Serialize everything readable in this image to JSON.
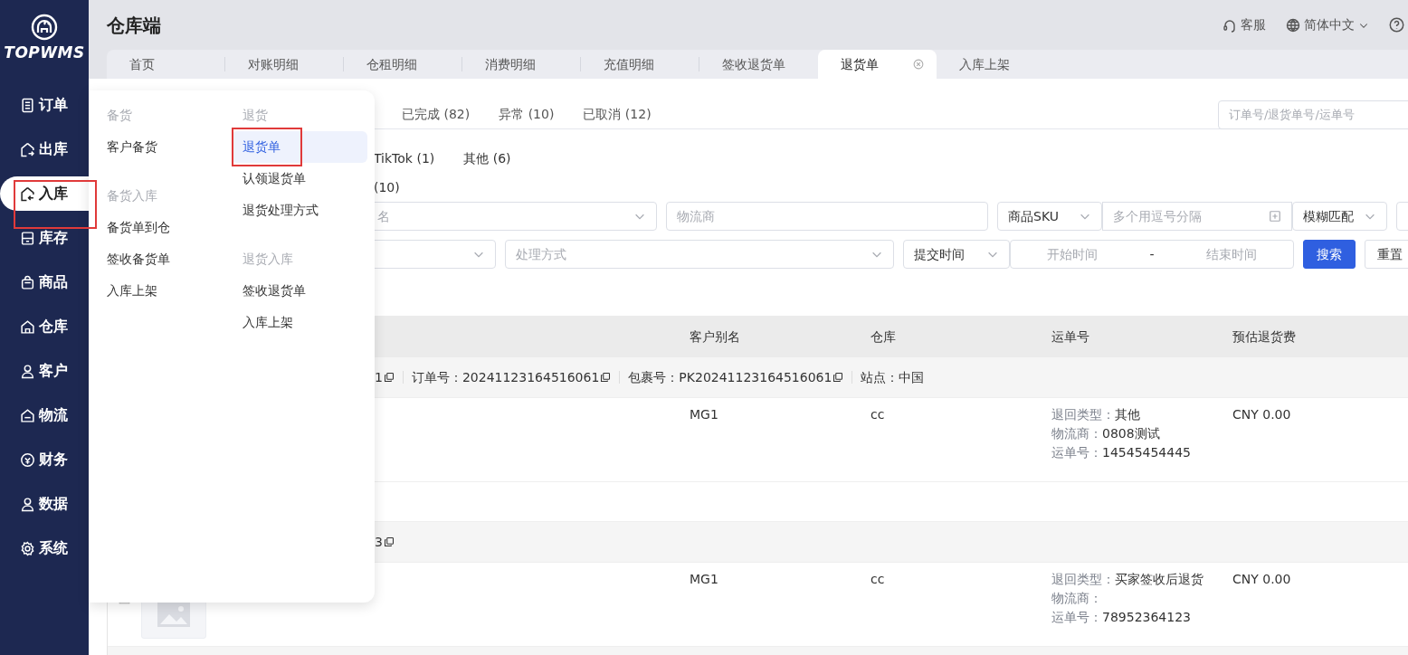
{
  "app": {
    "logo": "TOPWMS",
    "title": "仓库端"
  },
  "header_actions": [
    {
      "kind": "support",
      "label": "客服"
    },
    {
      "kind": "language",
      "label": "简体中文"
    },
    {
      "kind": "help"
    }
  ],
  "sidebar": {
    "items": [
      {
        "kind": "order",
        "label": "订单",
        "selected": false
      },
      {
        "kind": "outbound",
        "label": "出库",
        "selected": false
      },
      {
        "kind": "inbound",
        "label": "入库",
        "selected": true,
        "highlighted": true
      },
      {
        "kind": "inventory",
        "label": "库存",
        "selected": false
      },
      {
        "kind": "product",
        "label": "商品",
        "selected": false
      },
      {
        "kind": "warehouse",
        "label": "仓库",
        "selected": false
      },
      {
        "kind": "customer",
        "label": "客户",
        "selected": false
      },
      {
        "kind": "logistics",
        "label": "物流",
        "selected": false
      },
      {
        "kind": "finance",
        "label": "财务",
        "selected": false
      },
      {
        "kind": "data",
        "label": "数据",
        "selected": false
      },
      {
        "kind": "system",
        "label": "系统",
        "selected": false
      }
    ]
  },
  "page_tabs": [
    {
      "label": "首页",
      "selected": false
    },
    {
      "label": "对账明细",
      "selected": false
    },
    {
      "label": "仓租明细",
      "selected": false
    },
    {
      "label": "消费明细",
      "selected": false
    },
    {
      "label": "充值明细",
      "selected": false
    },
    {
      "label": "签收退货单",
      "selected": false
    },
    {
      "label": "退货单",
      "selected": true
    },
    {
      "label": "入库上架",
      "selected": false
    }
  ],
  "status_tabs": [
    {
      "label": "已完成 (82)",
      "selected": false
    },
    {
      "label": "异常 (10)",
      "selected": false
    },
    {
      "label": "已取消 (12)",
      "selected": false
    }
  ],
  "search": {
    "placeholder": "订单号/退货单号/运单号"
  },
  "platform_filters": [
    {
      "label": "TikTok (1)",
      "selected": false
    },
    {
      "label": "其他 (6)",
      "selected": false
    }
  ],
  "type_filters": [
    {
      "label": "(10)",
      "selected": false
    }
  ],
  "filter_rows": [
    [
      {
        "kind": "select",
        "placeholder": "名"
      },
      {
        "kind": "input",
        "placeholder": "物流商"
      },
      {
        "kind": "select",
        "value": "商品SKU"
      },
      {
        "kind": "multi_input",
        "placeholder": "多个用逗号分隔"
      },
      {
        "kind": "select",
        "value": "模糊匹配"
      },
      {
        "kind": "input"
      }
    ],
    [
      {
        "kind": "select"
      },
      {
        "kind": "select",
        "placeholder": "处理方式"
      },
      {
        "kind": "select",
        "value": "提交时间"
      },
      {
        "kind": "date_range",
        "start_placeholder": "开始时间",
        "separator": "-",
        "end_placeholder": "结束时间"
      },
      {
        "kind": "button",
        "label": "搜索",
        "primary": true
      },
      {
        "kind": "button",
        "label": "重置",
        "primary": false
      }
    ]
  ],
  "table": {
    "columns": [
      "客户别名",
      "仓库",
      "运单号",
      "预估退货费"
    ],
    "groups": [
      {
        "meta": [
          {
            "text": "1",
            "copy": true
          },
          {
            "text": "订单号：20241123164516061",
            "copy": true
          },
          {
            "text": "包裹号：PK20241123164516061",
            "copy": true
          },
          {
            "text": "站点：中国",
            "copy": false
          }
        ],
        "row": {
          "customer": "MG1",
          "warehouse": "cc",
          "tracking": [
            {
              "label": "退回类型：",
              "value": "其他"
            },
            {
              "label": "物流商：",
              "value": "0808测试"
            },
            {
              "label": "运单号：",
              "value": "14545454445"
            }
          ],
          "fee": "CNY 0.00"
        }
      },
      {
        "meta": [
          {
            "text": "3",
            "copy": true
          }
        ],
        "row": {
          "thumbnail": true,
          "customer": "MG1",
          "warehouse": "cc",
          "tracking": [
            {
              "label": "退回类型：",
              "value": "买家签收后退货"
            },
            {
              "label": "物流商："
            },
            {
              "label": "运单号：",
              "value": "78952364123"
            }
          ],
          "fee": "CNY 0.00"
        }
      }
    ]
  },
  "menu": {
    "columns": [
      {
        "sections": [
          {
            "title": "备货",
            "items": [
              {
                "label": "客户备货",
                "selected": false
              }
            ]
          },
          {
            "title": "备货入库",
            "items": [
              {
                "label": "备货单到仓",
                "selected": false
              },
              {
                "label": "签收备货单",
                "selected": false
              },
              {
                "label": "入库上架",
                "selected": false
              }
            ]
          }
        ]
      },
      {
        "sections": [
          {
            "title": "退货",
            "items": [
              {
                "label": "退货单",
                "selected": true,
                "highlighted": true
              },
              {
                "label": "认领退货单",
                "selected": false
              },
              {
                "label": "退货处理方式",
                "selected": false
              }
            ]
          },
          {
            "title": "退货入库",
            "items": [
              {
                "label": "签收退货单",
                "selected": false
              },
              {
                "label": "入库上架",
                "selected": false
              }
            ]
          }
        ]
      }
    ]
  }
}
